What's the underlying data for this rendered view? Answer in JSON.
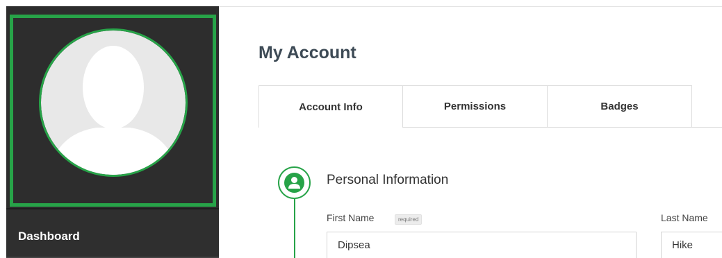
{
  "sidebar": {
    "avatar": {
      "icon": "user-silhouette-icon",
      "accent": "#27a348"
    },
    "items": [
      {
        "label": "Dashboard"
      }
    ]
  },
  "main": {
    "title": "My Account",
    "tabs": [
      {
        "label": "Account Info",
        "active": true
      },
      {
        "label": "Permissions",
        "active": false
      },
      {
        "label": "Badges",
        "active": false
      }
    ],
    "section": {
      "icon": "user-icon",
      "heading": "Personal Information",
      "fields": {
        "first_name": {
          "label": "First Name",
          "badge": "required",
          "value": "Dipsea"
        },
        "last_name": {
          "label": "Last Name",
          "value": "Hike"
        }
      }
    }
  },
  "colors": {
    "accent": "#27a348",
    "sidebar_bg": "#2d2d2d",
    "title": "#3d4a55"
  }
}
